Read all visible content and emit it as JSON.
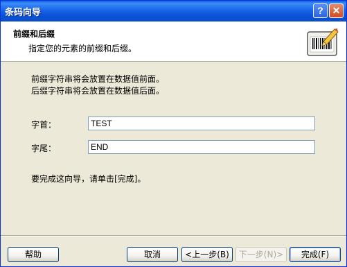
{
  "window": {
    "title": "条码向导",
    "help_glyph": "?",
    "close_glyph": "✕"
  },
  "header": {
    "title": "前缀和后缀",
    "subtitle": "指定您的元素的前缀和后缀。"
  },
  "body": {
    "line1": "前缀字符串将会放置在数据值前面。",
    "line2": "后缀字符串将会放置在数据值后面。",
    "prefix_label": "字首：",
    "prefix_value": "TEST",
    "suffix_label": "字尾：",
    "suffix_value": "END",
    "finish_hint": "要完成这向导，请单击[完成]。"
  },
  "buttons": {
    "help": "帮助",
    "cancel": "取消",
    "back": "<上一步(B)",
    "next": "下一步(N)>",
    "finish": "完成(F)"
  }
}
